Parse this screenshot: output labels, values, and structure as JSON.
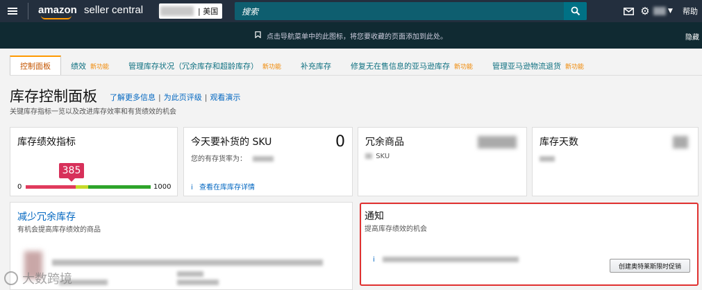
{
  "topbar": {
    "logo_amazon": "amazon",
    "logo_seller": "seller central",
    "marketplace": "| 美国",
    "search_placeholder": "搜索",
    "help": "帮助"
  },
  "banner": {
    "text": "点击导航菜单中的此图标，将您要收藏的页面添加到此处。",
    "hide": "隐藏"
  },
  "tabs": [
    {
      "label": "控制面板",
      "badge": ""
    },
    {
      "label": "绩效",
      "badge": "新功能"
    },
    {
      "label": "管理库存状况（冗余库存和超龄库存）",
      "badge": "新功能"
    },
    {
      "label": "补充库存",
      "badge": ""
    },
    {
      "label": "修复无在售信息的亚马逊库存",
      "badge": "新功能"
    },
    {
      "label": "管理亚马逊物流退货",
      "badge": "新功能"
    }
  ],
  "page": {
    "title": "库存控制面板",
    "links": [
      "了解更多信息",
      "为此页评级",
      "观看演示"
    ],
    "subtitle": "关键库存指标一览以及改进库存效率和有货绩效的机会"
  },
  "cards": {
    "ipi": {
      "title": "库存绩效指标",
      "score": "385",
      "min": "0",
      "max": "1000",
      "score_value": 385
    },
    "restock": {
      "title": "今天要补货的 SKU",
      "count": "0",
      "instock_label": "您的有存货率为：",
      "link": "查看在库库存详情"
    },
    "excess": {
      "title": "冗余商品",
      "unit": "SKU"
    },
    "days": {
      "title": "库存天数"
    },
    "reduce": {
      "title": "减少冗余库存",
      "subtitle": "有机会提高库存绩效的商品"
    },
    "notice": {
      "title": "通知",
      "subtitle": "提高库存绩效的机会",
      "button": "创建奥特莱斯限时促销"
    }
  },
  "watermark": "大数跨境"
}
